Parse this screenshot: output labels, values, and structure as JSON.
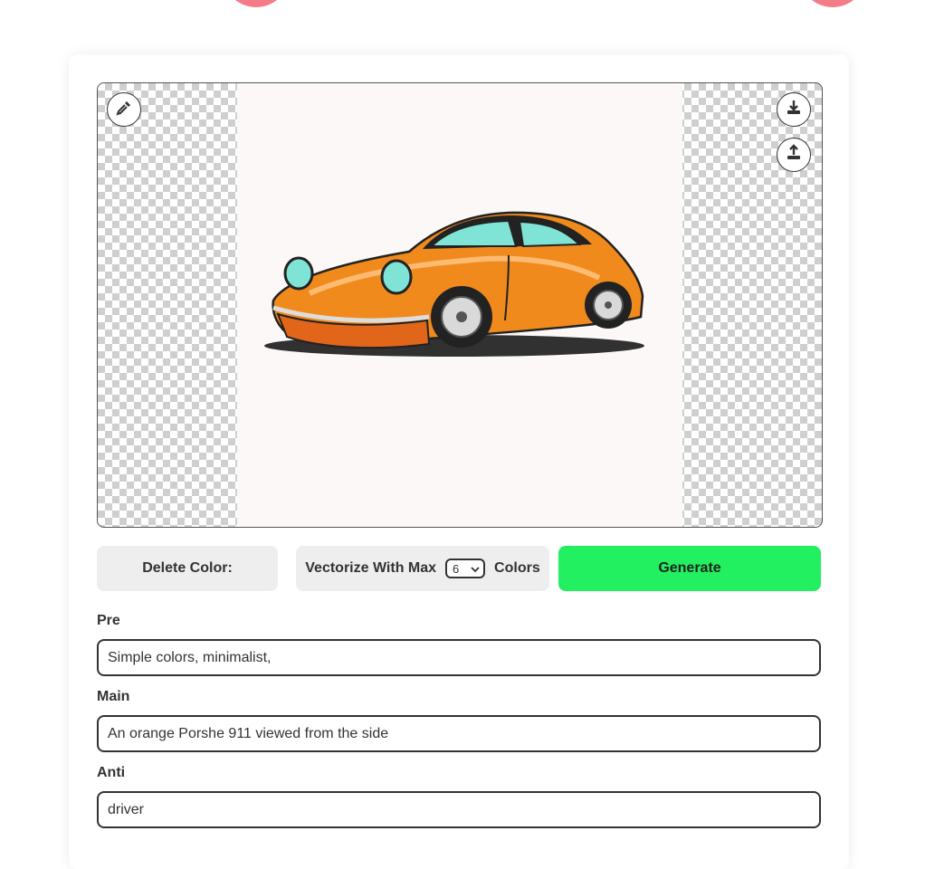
{
  "colors": {
    "accent_green": "#22f060",
    "deco_pink": "#f47b88",
    "button_gray": "#eeeeee",
    "car_orange": "#f08a1c"
  },
  "toolbar": {
    "eyedropper_icon": "eyedropper-icon",
    "download_icon": "download-icon",
    "upload_icon": "upload-icon"
  },
  "actions": {
    "delete_color_label": "Delete Color:",
    "vectorize_prefix": "Vectorize With Max",
    "vectorize_suffix": "Colors",
    "max_colors_value": "6",
    "generate_label": "Generate"
  },
  "prompts": {
    "pre_label": "Pre",
    "pre_value": "Simple colors, minimalist,",
    "main_label": "Main",
    "main_value": "An orange Porshe 911 viewed from the side",
    "anti_label": "Anti",
    "anti_value": "driver"
  }
}
